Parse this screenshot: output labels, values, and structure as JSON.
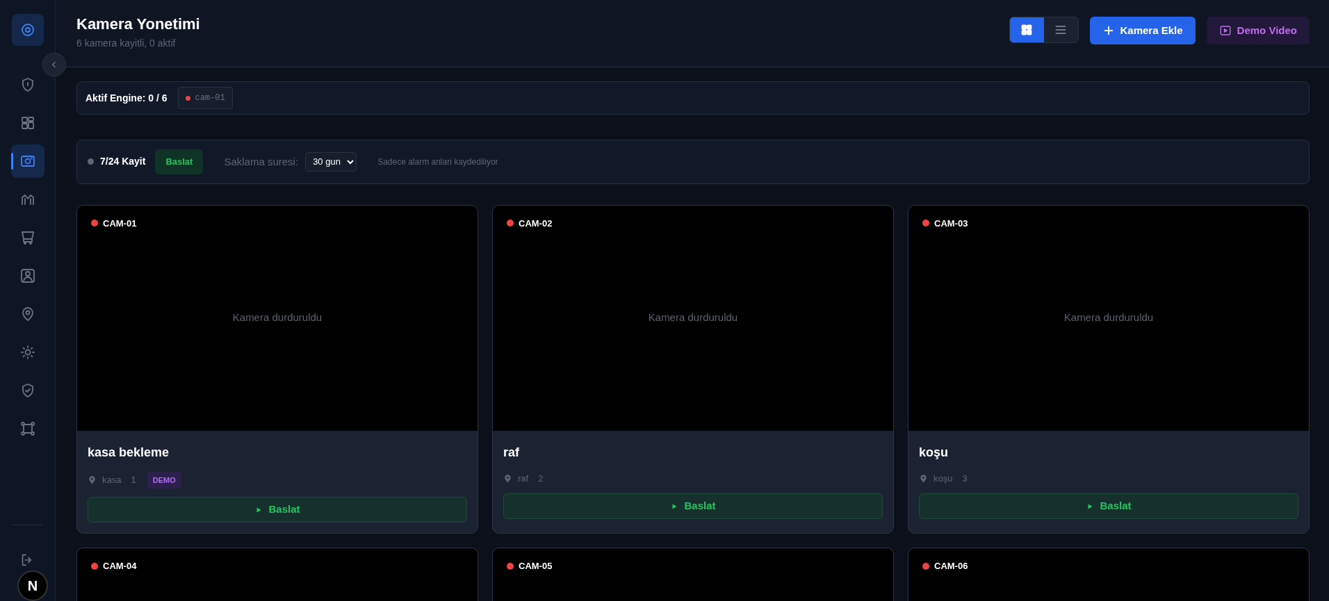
{
  "sidebar": {
    "items": [
      {
        "kind": "shield",
        "selected": false
      },
      {
        "kind": "grid",
        "selected": false
      },
      {
        "kind": "camera",
        "selected": true
      },
      {
        "kind": "chart",
        "selected": false
      },
      {
        "kind": "cart",
        "selected": false
      },
      {
        "kind": "people",
        "selected": false
      },
      {
        "kind": "pin",
        "selected": false
      },
      {
        "kind": "sun",
        "selected": false
      },
      {
        "kind": "check",
        "selected": false
      },
      {
        "kind": "frame",
        "selected": false
      }
    ],
    "badge": "N"
  },
  "header": {
    "title": "Kamera Yonetimi",
    "subtitle": "6 kamera kayitli, 0 aktif",
    "view_toggle": [
      {
        "kind": "grid",
        "selected": true
      },
      {
        "kind": "list",
        "selected": false
      }
    ],
    "add_button": "Kamera Ekle",
    "demo_button": "Demo Video"
  },
  "engine": {
    "label": "Aktif Engine: 0 / 6",
    "chips": [
      {
        "label": "cam-01",
        "color": "#ef4444"
      }
    ]
  },
  "recording": {
    "active": false,
    "label": "7/24 Kayit",
    "button": "Baslat",
    "retention_label": "Saklama suresi:",
    "retention_value": "30 gun",
    "note": "Sadece alarm anlari kaydediliyor"
  },
  "cameras": [
    {
      "id": "CAM-01",
      "active": false,
      "status": "Kamera durduruldu",
      "name": "kasa bekleme",
      "location": "kasa",
      "number": "1",
      "badge": "DEMO",
      "button": "Baslat"
    },
    {
      "id": "CAM-02",
      "active": false,
      "status": "Kamera durduruldu",
      "name": "raf",
      "location": "raf",
      "number": "2",
      "button": "Baslat"
    },
    {
      "id": "CAM-03",
      "active": false,
      "status": "Kamera durduruldu",
      "name": "koşu",
      "location": "koşu",
      "number": "3",
      "button": "Baslat"
    },
    {
      "id": "CAM-04",
      "active": false
    },
    {
      "id": "CAM-05",
      "active": false
    },
    {
      "id": "CAM-06",
      "active": false
    }
  ]
}
